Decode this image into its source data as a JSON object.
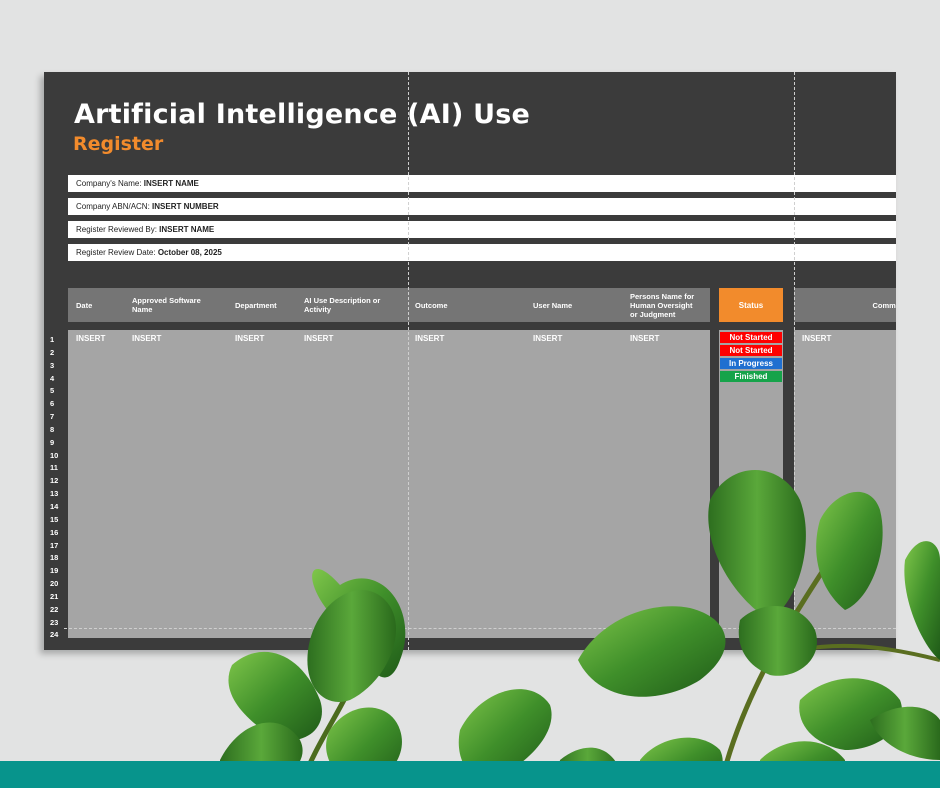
{
  "title": "Artificial Intelligence (AI) Use",
  "subtitle": "Register",
  "info": [
    {
      "label": "Company's Name: ",
      "value": "INSERT NAME"
    },
    {
      "label": "Company ABN/ACN: ",
      "value": "INSERT NUMBER"
    },
    {
      "label": "Register Reviewed By: ",
      "value": "INSERT NAME"
    },
    {
      "label": "Register Review Date: ",
      "value": "October 08, 2025"
    }
  ],
  "columns": {
    "date": "Date",
    "software": "Approved Software\nName",
    "department": "Department",
    "description": "AI Use Description or\nActivity",
    "outcome": "Outcome",
    "user": "User Name",
    "persons": "Persons Name for\nHuman Oversight\nor Judgment",
    "status": "Status",
    "comments": "Comme"
  },
  "placeholder": "INSERT",
  "row_numbers": [
    "1",
    "2",
    "3",
    "4",
    "5",
    "6",
    "7",
    "8",
    "9",
    "10",
    "11",
    "12",
    "13",
    "14",
    "15",
    "16",
    "17",
    "18",
    "19",
    "20",
    "21",
    "22",
    "23",
    "24"
  ],
  "status_options": [
    {
      "label": "Not Started",
      "color": "#ff0000"
    },
    {
      "label": "Not Started",
      "color": "#ff0000"
    },
    {
      "label": "In Progress",
      "color": "#1f6fd0"
    },
    {
      "label": "Finished",
      "color": "#16a34a"
    }
  ],
  "colors": {
    "accent": "#f28b2c",
    "banner": "#07948c",
    "sheet": "#3b3b3b"
  }
}
